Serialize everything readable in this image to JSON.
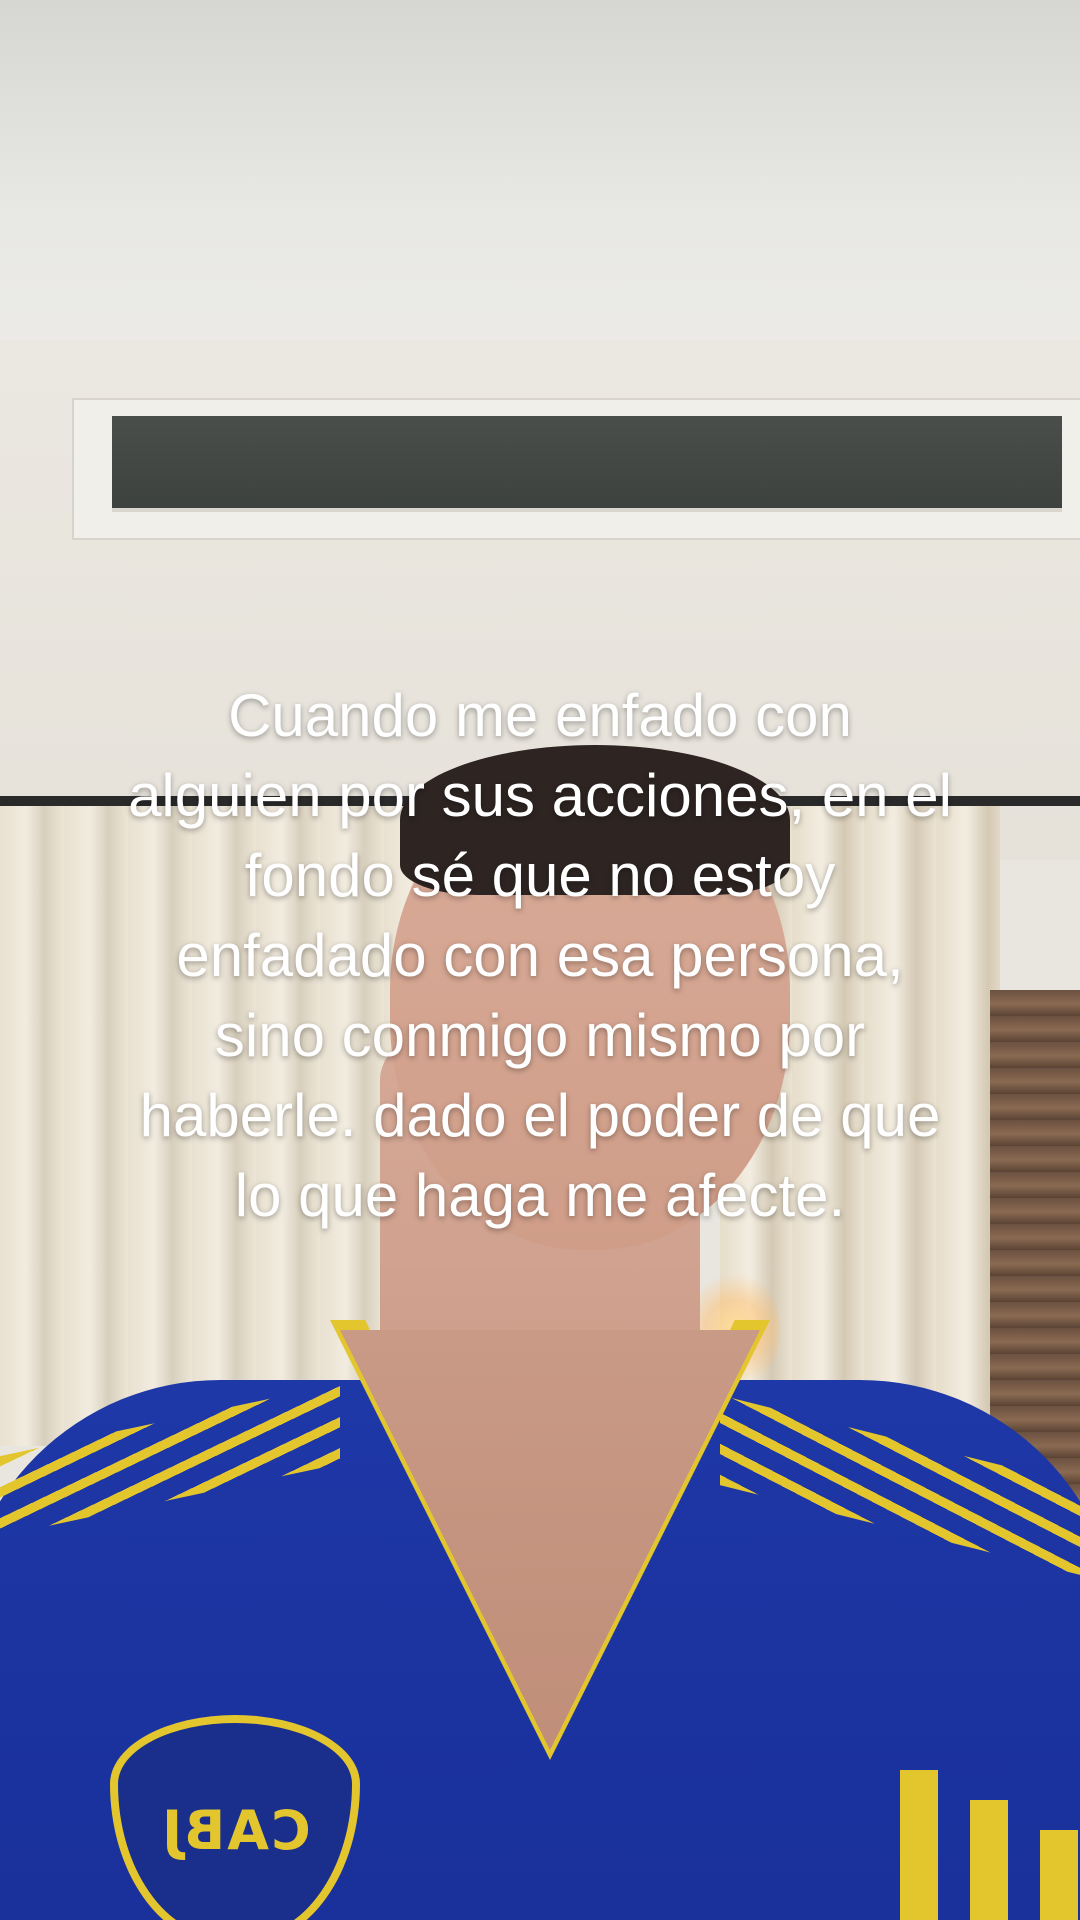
{
  "caption": {
    "lines": [
      "Cuando me enfado con",
      "alguien por sus acciones, en el",
      "fondo sé que no estoy",
      "enfadado con esa persona,",
      "sino conmigo mismo por",
      "haberle. dado el poder de que",
      "lo que haga me afecte."
    ]
  },
  "jersey": {
    "crest_text": "CABJ",
    "primary_color": "#1f38a8",
    "accent_color": "#e3c52e"
  }
}
